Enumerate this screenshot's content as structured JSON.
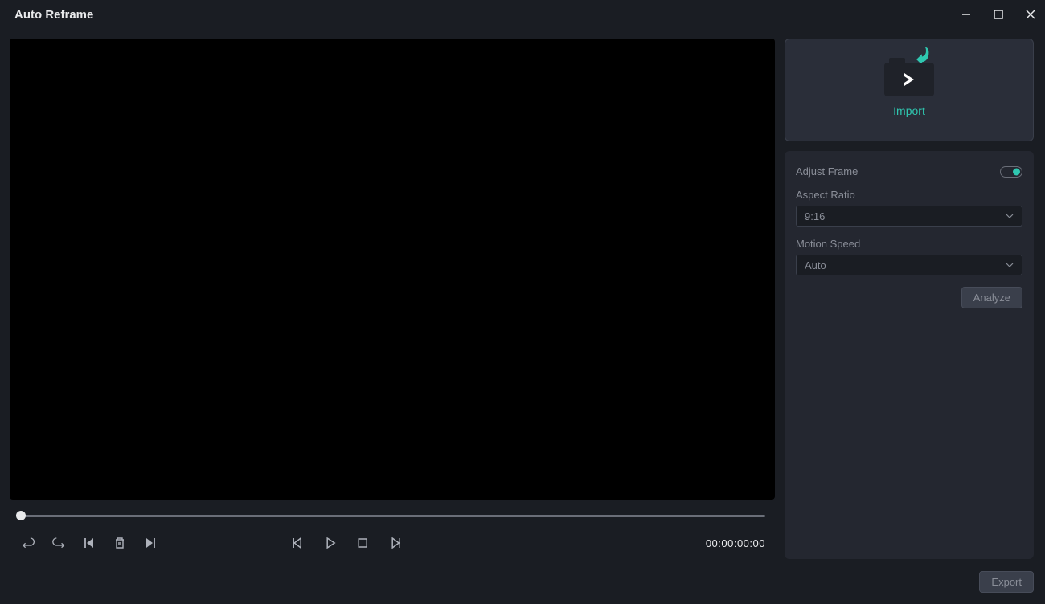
{
  "window": {
    "title": "Auto Reframe"
  },
  "preview": {
    "timecode": "00:00:00:00"
  },
  "sidebar": {
    "import_label": "Import",
    "adjust_frame_label": "Adjust Frame",
    "aspect_ratio_label": "Aspect Ratio",
    "aspect_ratio_value": "9:16",
    "motion_speed_label": "Motion Speed",
    "motion_speed_value": "Auto",
    "analyze_label": "Analyze"
  },
  "footer": {
    "export_label": "Export"
  },
  "colors": {
    "accent": "#2fc7b0",
    "bg": "#1a1d23",
    "panel": "#242730"
  }
}
